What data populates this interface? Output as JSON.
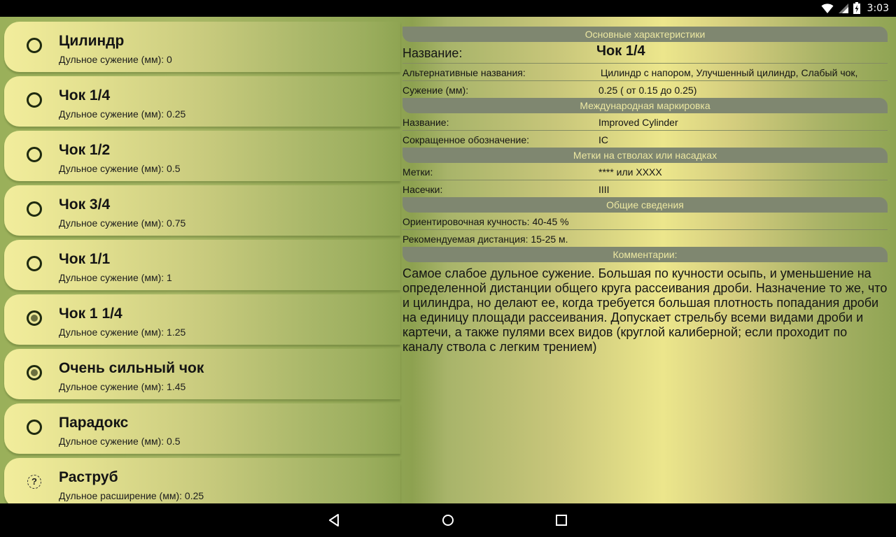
{
  "status": {
    "time": "3:03"
  },
  "list": [
    {
      "title": "Цилиндр",
      "sub": "Дульное сужение (мм): 0",
      "icon": "radio"
    },
    {
      "title": "Чок 1/4",
      "sub": "Дульное сужение (мм): 0.25",
      "icon": "radio"
    },
    {
      "title": "Чок 1/2",
      "sub": "Дульное сужение (мм): 0.5",
      "icon": "radio"
    },
    {
      "title": "Чок 3/4",
      "sub": "Дульное сужение (мм): 0.75",
      "icon": "radio"
    },
    {
      "title": "Чок 1/1",
      "sub": "Дульное сужение (мм): 1",
      "icon": "radio"
    },
    {
      "title": "Чок 1 1/4",
      "sub": "Дульное сужение (мм): 1.25",
      "icon": "radio-filled"
    },
    {
      "title": "Очень сильный чок",
      "sub": "Дульное сужение (мм): 1.45",
      "icon": "radio-filled"
    },
    {
      "title": "Парадокс",
      "sub": "Дульное сужение (мм): 0.5",
      "icon": "radio"
    },
    {
      "title": "Раструб",
      "sub": "Дульное расширение (мм): 0.25",
      "icon": "question-icon"
    }
  ],
  "details": {
    "s1": {
      "header": "Основные характеристики",
      "name_label": "Название:",
      "name_value": "Чок 1/4",
      "alt_label": "Альтернативные названия:",
      "alt_value": "Цилиндр с напором, Улучшенный цилиндр, Слабый чок,",
      "narrow_label": "Сужение (мм):",
      "narrow_value": "0.25 ( от 0.15  до  0.25)"
    },
    "s2": {
      "header": "Международная маркировка",
      "name_label": "Название:",
      "name_value": "Improved Cylinder",
      "abbr_label": "Сокращенное обозначение:",
      "abbr_value": "IC"
    },
    "s3": {
      "header": "Метки на стволах или насадках",
      "marks_label": "Метки:",
      "marks_value": "**** или XXXX",
      "notches_label": "Насечки:",
      "notches_value": "IIII"
    },
    "s4": {
      "header": "Общие сведения",
      "density": "Ориентировочная кучность: 40-45 %",
      "distance": "Рекомендуемая дистанция: 15-25 м."
    },
    "s5": {
      "header": "Комментарии:",
      "text": "Самое слабое дульное сужение. Большая по кучности осыпь, и уменьшение на определенной дистанции общего круга рассеивания дроби. Назначение то же, что и цилиндра, но делают ее, когда требуется большая плотность попадания дроби на единицу площади рассеивания. Допускает стрельбу всеми видами дроби и картечи, а также пулями всех видов (круглой калиберной; если проходит по каналу ствола с легким трением)"
    }
  },
  "icons": {
    "status": [
      "wifi-icon",
      "signal-icon",
      "battery-charging-icon"
    ],
    "nav": [
      "back-icon",
      "home-icon",
      "recents-icon"
    ]
  },
  "colors": {
    "header_bg": "#7f8770",
    "header_text": "#ede8a2",
    "item_light": "#f2ed9c"
  }
}
